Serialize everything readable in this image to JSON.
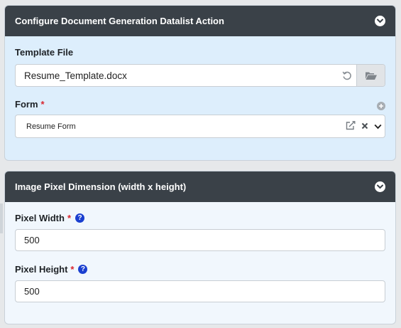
{
  "panel1": {
    "title": "Configure Document Generation Datalist Action",
    "template_label": "Template File",
    "template_value": "Resume_Template.docx",
    "form_label": "Form",
    "form_required": "*",
    "form_value": "Resume Form"
  },
  "panel2": {
    "title": "Image Pixel Dimension (width x height)",
    "width_label": "Pixel Width",
    "width_required": "*",
    "width_help": "?",
    "width_value": "500",
    "height_label": "Pixel Height",
    "height_required": "*",
    "height_help": "?",
    "height_value": "500"
  },
  "icons": {
    "collapse": "chevron-down-circle-icon",
    "reset": "undo-icon",
    "browse": "folder-open-icon",
    "add": "plus-circle-icon",
    "edit": "external-edit-icon",
    "clear": "close-icon",
    "dropdown": "chevron-down-icon",
    "help": "question-circle-icon"
  },
  "colors": {
    "header_bg": "#3a4148",
    "panel1_bg": "#ddeefc",
    "panel2_bg": "#f1f7fd",
    "required": "#d9262f",
    "help": "#1a3fd0"
  }
}
